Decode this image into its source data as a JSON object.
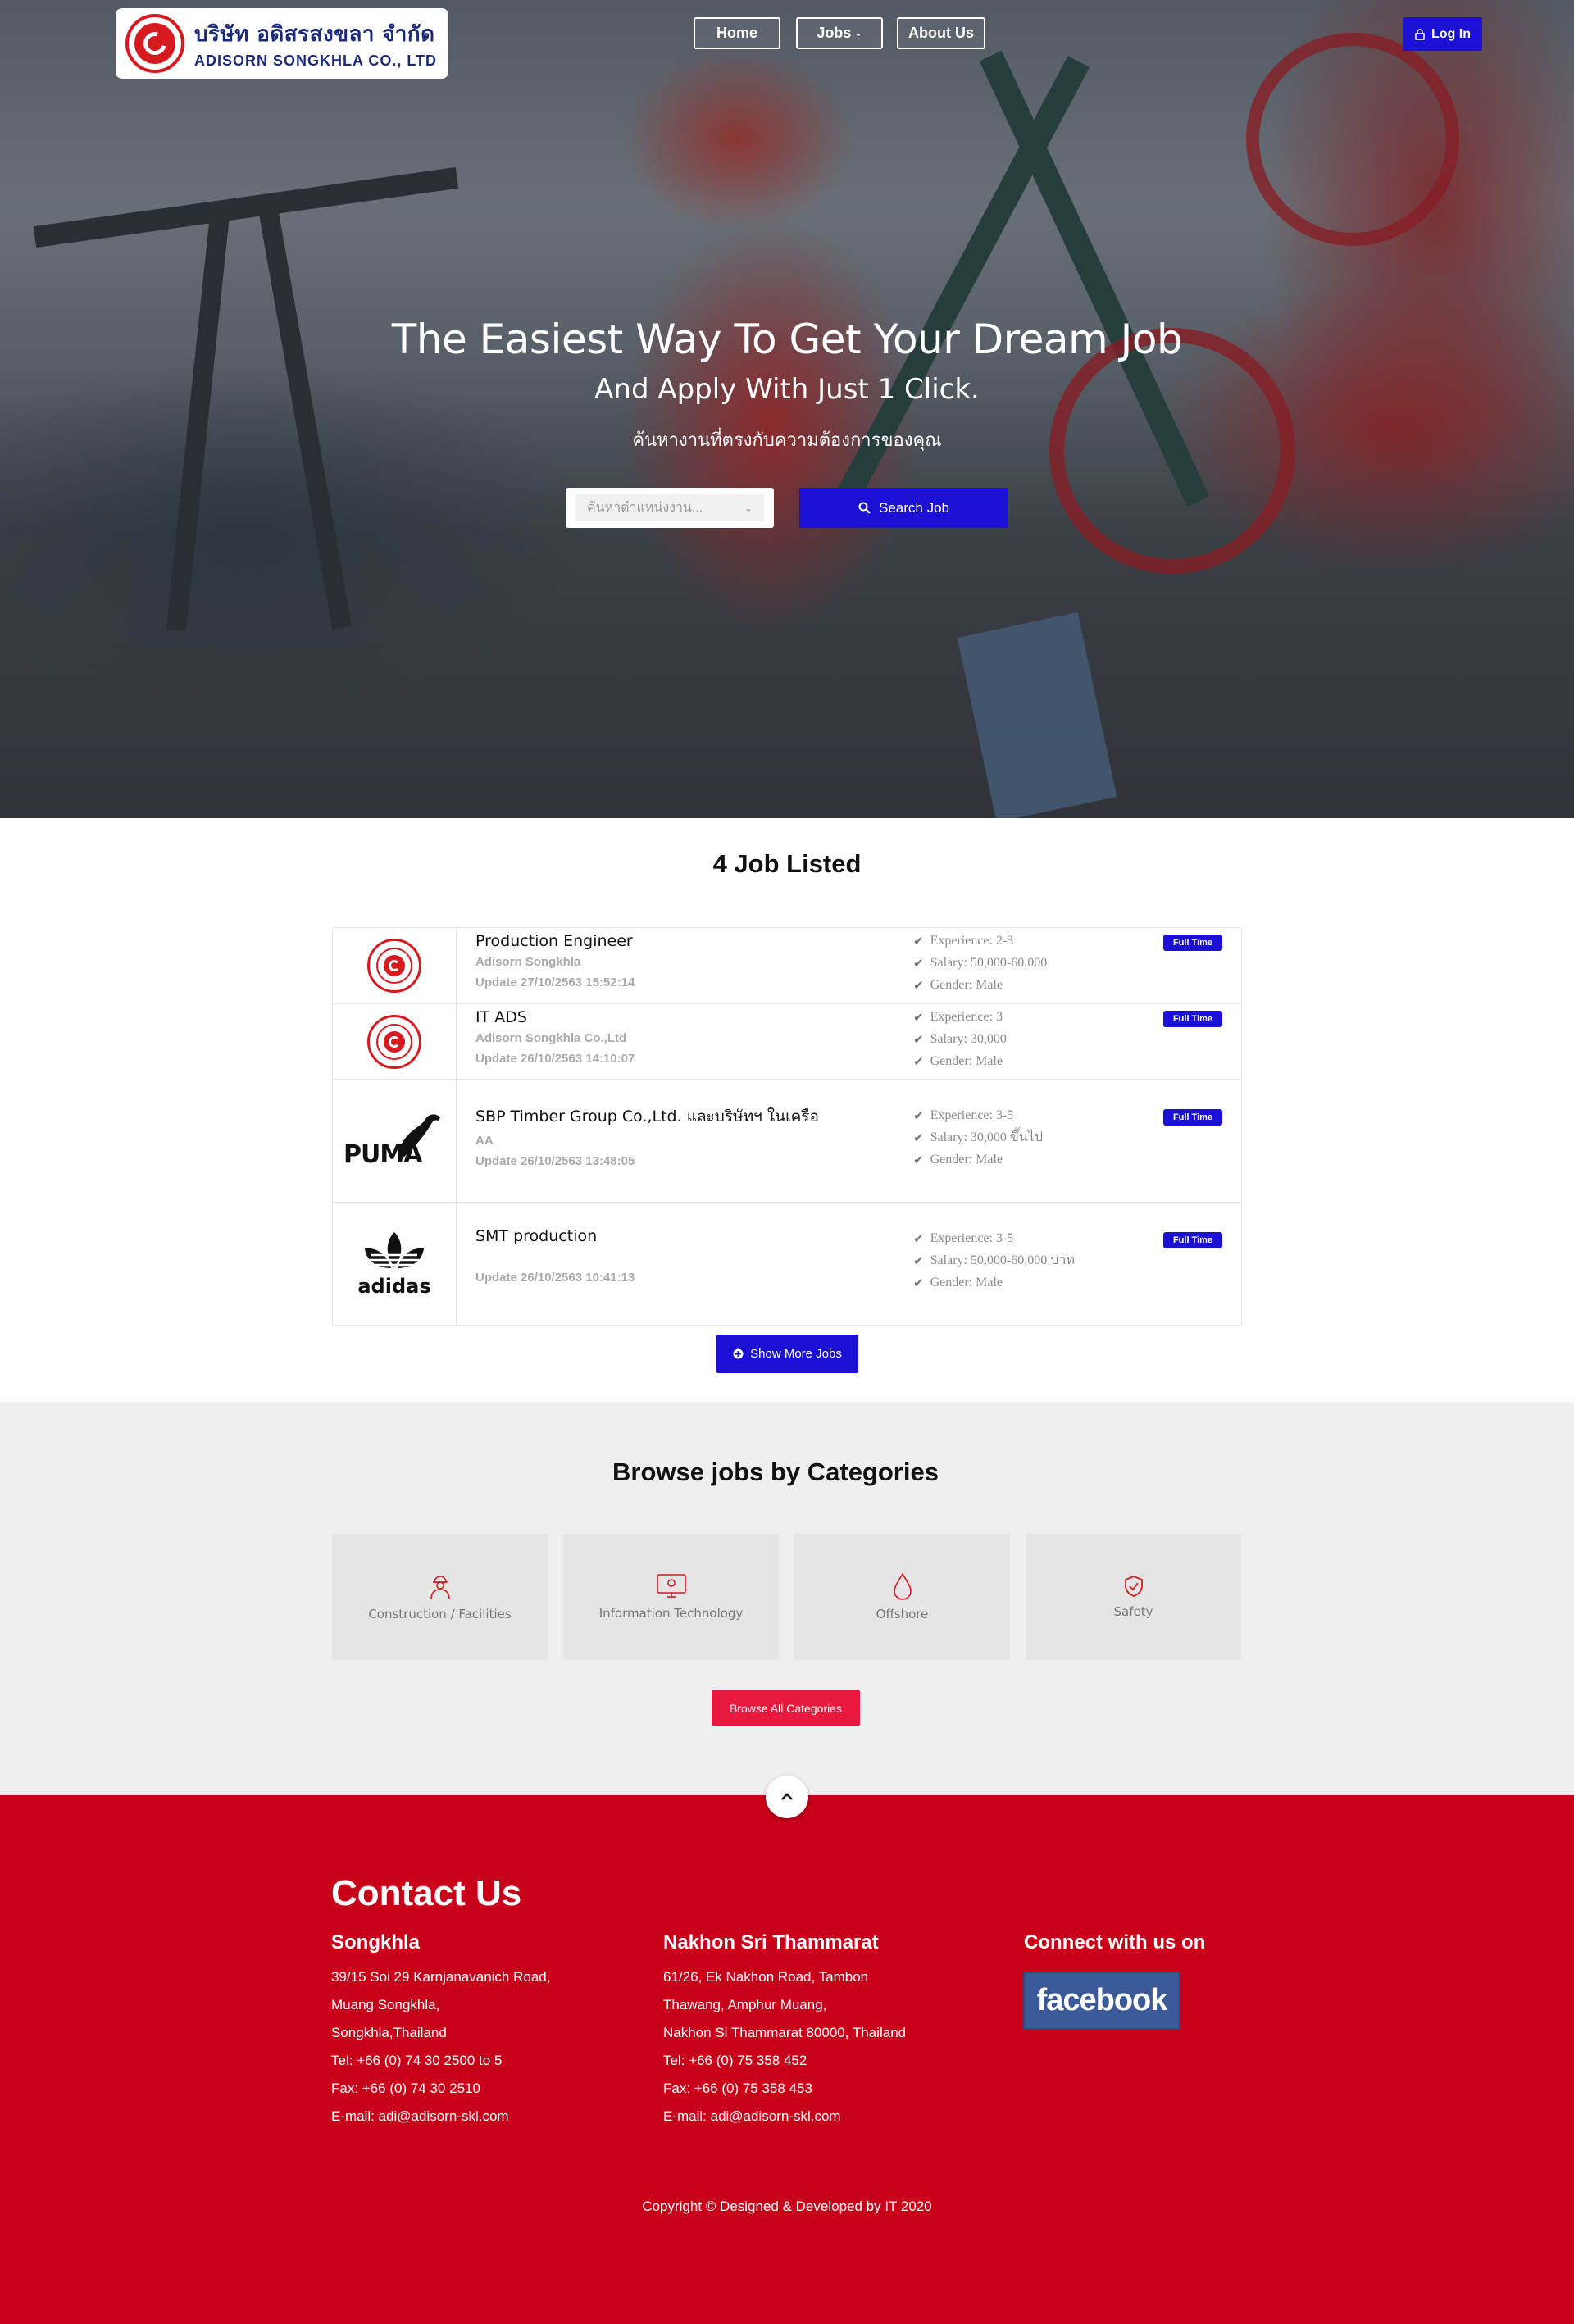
{
  "header": {
    "logo": {
      "thai": "บริษัท อดิสรสงขลา จำกัด",
      "english": "ADISORN SONGKHLA CO., LTD"
    },
    "nav": {
      "home": "Home",
      "jobs": "Jobs",
      "about": "About Us"
    },
    "login": "Log In"
  },
  "hero": {
    "title": "The Easiest Way To Get Your Dream Job",
    "subtitle": "And Apply With Just 1 Click.",
    "thai_subtitle": "ค้นหางานที่ตรงกับความต้องการของคุณ",
    "search_placeholder": "ค้นหาตำแหน่งงาน...",
    "search_button": "Search Job"
  },
  "jobs": {
    "heading": "4 Job Listed",
    "items": [
      {
        "title": "Production Engineer",
        "company": "Adisorn Songkhla",
        "update": "Update 27/10/2563 15:52:14",
        "experience": "Experience:  2-3",
        "salary": "Salary:  50,000-60,000",
        "gender": "Gender:  Male",
        "badge": "Full Time",
        "logo": "adisorn-logo"
      },
      {
        "title": "IT ADS",
        "company": "Adisorn Songkhla Co.,Ltd",
        "update": "Update 26/10/2563 14:10:07",
        "experience": "Experience:  3",
        "salary": "Salary:  30,000",
        "gender": "Gender:  Male",
        "badge": "Full Time",
        "logo": "adisorn-logo"
      },
      {
        "title": "SBP Timber Group Co.,Ltd. และบริษัทฯ ในเครือ",
        "company": "AA",
        "update": "Update 26/10/2563 13:48:05",
        "experience": "Experience:  3-5",
        "salary": "Salary:  30,000  ขึ้นไป",
        "gender": "Gender:  Male",
        "badge": "Full Time",
        "logo": "puma-logo"
      },
      {
        "title": "SMT production",
        "company": "",
        "update": "Update 26/10/2563 10:41:13",
        "experience": "Experience:  3-5",
        "salary": "Salary:  50,000-60,000  บาท",
        "gender": "Gender:  Male",
        "badge": "Full Time",
        "logo": "adidas-logo"
      }
    ],
    "show_more": "Show More Jobs",
    "logo_text": {
      "puma": "PUMA",
      "adidas": "adidas"
    }
  },
  "categories": {
    "heading": "Browse jobs by Categories",
    "items": [
      {
        "label": "Construction / Facilities",
        "icon": "worker-icon"
      },
      {
        "label": "Information Technology",
        "icon": "monitor-icon"
      },
      {
        "label": "Offshore",
        "icon": "drop-icon"
      },
      {
        "label": "Safety",
        "icon": "shield-check-icon"
      }
    ],
    "browse_all": "Browse All Categories"
  },
  "footer": {
    "heading": "Contact Us",
    "songkhla": {
      "title": "Songkhla",
      "lines": [
        "39/15 Soi 29 Karnjanavanich Road,",
        "Muang Songkhla,",
        "Songkhla,Thailand",
        "Tel: +66 (0) 74 30 2500 to 5",
        "Fax: +66 (0) 74 30 2510",
        "E-mail: adi@adisorn-skl.com"
      ]
    },
    "nakhon": {
      "title": "Nakhon Sri Thammarat",
      "lines": [
        "61/26, Ek Nakhon Road, Tambon",
        "Thawang, Amphur Muang,",
        "Nakhon Si Thammarat 80000, Thailand",
        "Tel: +66 (0) 75 358 452",
        "Fax: +66 (0) 75 358 453",
        "E-mail: adi@adisorn-skl.com"
      ]
    },
    "connect": {
      "title": "Connect with us on",
      "facebook": "facebook"
    },
    "copyright": "Copyright © Designed & Developed by IT 2020"
  },
  "colors": {
    "primary_blue": "#1c0fd6",
    "brand_red": "#c8001a",
    "accent_red": "#e8193c"
  }
}
